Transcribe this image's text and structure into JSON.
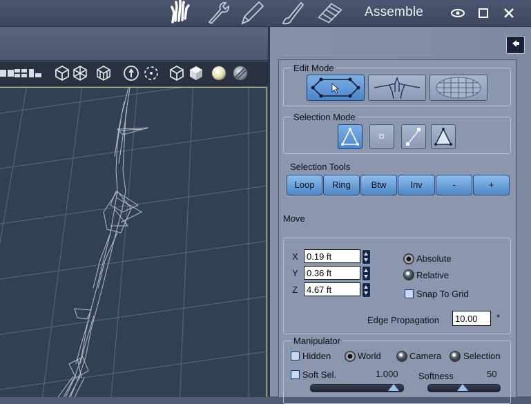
{
  "window": {
    "title": "Assemble",
    "controls": [
      "eye-icon",
      "maximize-icon",
      "close-icon"
    ]
  },
  "rooms": [
    "hand-icon",
    "wrench-icon",
    "pencil-icon",
    "brush-icon",
    "film-icon"
  ],
  "viewport_toolbar": {
    "icons": [
      "layout-1-icon",
      "layout-2-icon",
      "layout-3-icon",
      "bounding-box-icon",
      "wireframe-icon",
      "hidden-line-icon",
      "pan-icon",
      "orbit-icon",
      "cube-icon",
      "smooth-shaded-icon",
      "sphere-lit-icon",
      "sphere-textured-icon"
    ]
  },
  "panel": {
    "edit_mode": {
      "label": "Edit Mode",
      "buttons": [
        "polygon-edit-icon",
        "figure-edit-icon",
        "sphere-grid-icon"
      ],
      "active_index": 0
    },
    "selection_mode": {
      "label": "Selection Mode",
      "buttons": [
        "triangle-select-icon",
        "point-select-icon",
        "edge-select-icon",
        "face-select-icon"
      ],
      "active_index": 0
    },
    "selection_tools": {
      "label": "Selection Tools",
      "buttons": [
        "Loop",
        "Ring",
        "Btw",
        "Inv",
        "-",
        "+"
      ]
    },
    "move": {
      "label": "Move",
      "x_label": "X",
      "x_value": "0.19 ft",
      "y_label": "Y",
      "y_value": "0.36 ft",
      "z_label": "Z",
      "z_value": "4.67 ft",
      "absolute": "Absolute",
      "relative": "Relative",
      "snap": "Snap To Grid",
      "edge_label": "Edge Propagation",
      "edge_value": "10.00",
      "edge_suffix": "*"
    },
    "manipulator": {
      "label": "Manipulator",
      "hidden": "Hidden",
      "world": "World",
      "camera": "Camera",
      "selection": "Selection",
      "soft_sel": "Soft Sel.",
      "soft_sel_value": "1.000",
      "softness": "Softness",
      "softness_value": "50"
    }
  },
  "colors": {
    "accent": "#4f88c6",
    "viewport": "#324053",
    "panel": "#8b97ae"
  }
}
